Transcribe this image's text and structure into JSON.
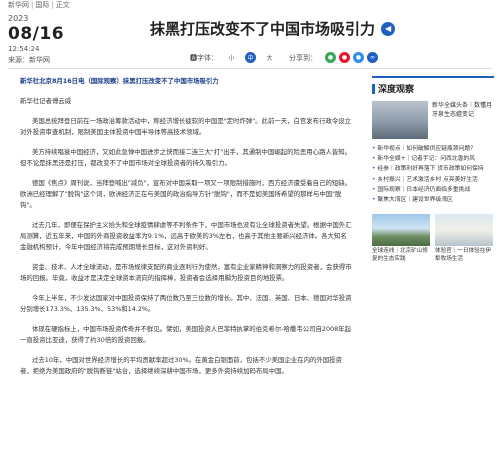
{
  "breadcrumb": [
    "新华网",
    "国际",
    "正文"
  ],
  "meta": {
    "year": "2023",
    "month_day": "08/16",
    "time": "12:54:24",
    "source": "来源：新华网"
  },
  "article": {
    "title": "抹黑打压改变不了中国市场吸引力",
    "paragraphs": [
      "新华社北京8月16日电（国际观察）抹黑打压改变不了中国市场吸引力",
      "新华社记者傅云威",
      "美国总统拜登日前在一场政治筹款活动中，称经济增长疲软的中国是\"定时炸弹\"。此前一天，白宫发布行政令设立对外投资审查机制，限制美国主体投资中国半导体等高技术领域。",
      "美方持续唱衰中国经济，又如此急惮中国进步之快而接二连三大\"打\"出手，其通制中国崛起的险恶用心路人皆知。但不论是抹黑还是打压，都改变不了中国市场对全球投资者的持久吸引力。",
      "德国《焦点》周刊说，当拜登喊出\"减负\"，宣布对中国采取一项又一项限制措施时，西方经济遭受着自己的短缺。欧洲已经理解了\"脱钩\"这个词，欧洲经济正在与美国的政治指导方针\"脱钩\"，而不是如美国所希望的那样与中国\"脱钩\"。",
      "过去几年，即便在保护主义抬头和全球疫情肆虐等不利条件下，中国市场也没有让全球投资者失望。根据中国外汇局测算，近五年来，中国的外商投资收益率为9.1%，远高于欧美的3%左右，也高于其他主要新兴经济体。各大知名金融机构预计，今年中国经济将完成预期增长目标，这对外资利好。",
      "资金、技术、人才全球流动，是市场规律支配的商业逐利行为使然，富有企业家精神和洞察力的投资者，会获得市场的回报。毕竟，收益才是决定全球资本流向的指挥棒，投资者会选择用脚为投资目的地投票。",
      "今年上半年，不少发达国家对中国投资保持了两位数乃至三位数的增长。其中，法国、英国、日本、德国对华投资分别增长173.3%、135.3%、53%和14.2%。",
      "体现在硬指标上，中国市场投资传奇并不鲜见。譬如，美国投资人巴菲特执掌的伯克希尔-哈撒韦公司自2008年起一直投资比亚迪，获得了约30倍的投资回报。",
      "过去10年，中国对世界经济增长的平均贡献率超过30%。在黄金白银面前，包括不少美国企业在内的外国投资者，拒绝为美国政府的\"脱钩断链\"站台，选择继续深耕中国市场，更多外资持续加码布局中国。"
    ]
  },
  "toolbar": {
    "font_label": "字体：",
    "font_sizes": [
      "小",
      "中",
      "大"
    ],
    "share_label": "分享到："
  },
  "sidebar": {
    "title": "深度观察",
    "featured": {
      "text": "新华全媒头条｜数懂月牙泉生态嬗变记"
    },
    "items": [
      "新华视点｜如何破解供应链瓶颈问题？",
      "新华全媒+｜记者手记：问西北香的风",
      "经参｜政策利好再落下 货币政策如何保持",
      "乡村振兴｜艺术激活乡村 点亮美好生活",
      "国际观察｜日本经济仍面临多重挑战",
      "聚焦大湾区｜建设世界级湾区"
    ],
    "thumbs": [
      {
        "caption": "全球连线｜北京矿山修复的生态实践"
      },
      {
        "caption": "体验官｜一日体验在伊犁牧场生活"
      }
    ]
  },
  "colors": {
    "accent": "#1f5fbf",
    "wechat": "#34a853",
    "weibo": "#e6162d",
    "qq": "#2d8cf0"
  }
}
